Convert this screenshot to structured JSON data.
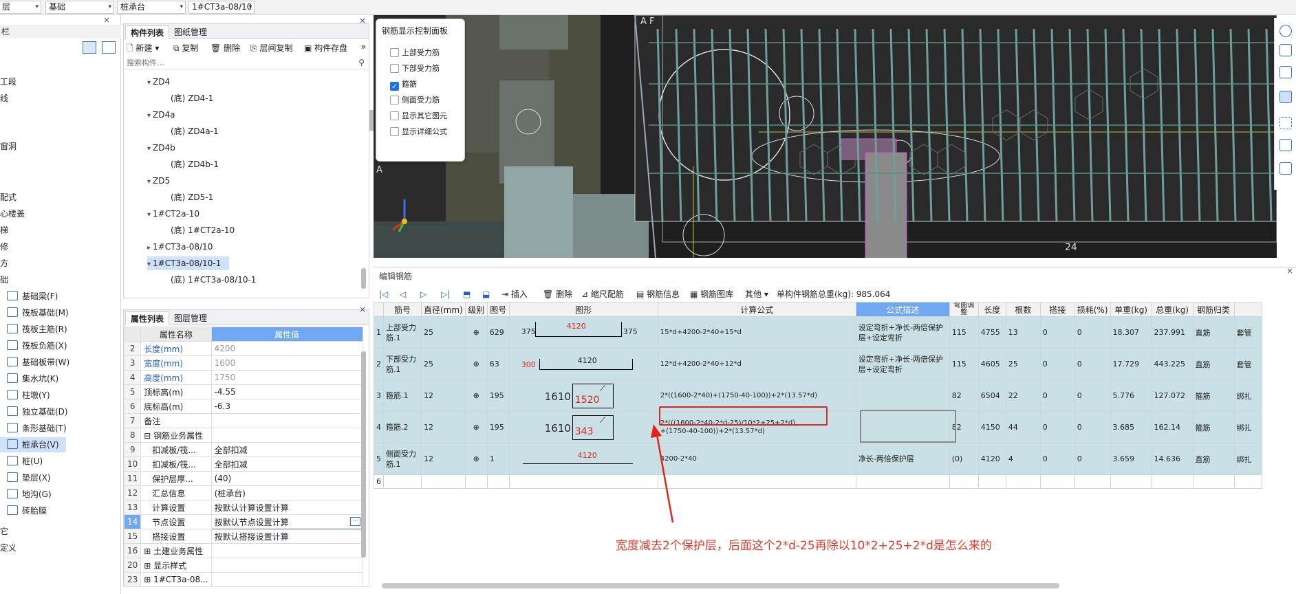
{
  "topbar": {
    "sel1": "层",
    "sel2": "基础",
    "sel3": "桩承台",
    "sel4": "1#CT3a-08/10"
  },
  "nav": {
    "header": "栏",
    "items": [
      "工段",
      "线",
      "窗洞",
      "配式",
      "心楼盖",
      "梯",
      "修",
      "方",
      "础"
    ],
    "foundation_items": [
      "基础梁(F)",
      "筏板基础(M)",
      "筏板主筋(R)",
      "筏板负筋(X)",
      "基础板带(W)",
      "集水坑(K)",
      "柱墩(Y)",
      "独立基础(D)",
      "条形基础(T)",
      "桩承台(V)",
      "桩(U)",
      "垫层(X)",
      "地沟(G)",
      "砖胎膜"
    ],
    "bottom_items": [
      "它",
      "定义"
    ]
  },
  "complist": {
    "tab_active": "构件列表",
    "tab2": "图纸管理",
    "btn_new": "新建",
    "btn_copy": "复制",
    "btn_delete": "删除",
    "btn_floor_copy": "层间复制",
    "btn_save": "构件存盘",
    "search_placeholder": "搜索构件...",
    "tree": [
      {
        "label": "ZD4",
        "level": 0,
        "arrow": "▾"
      },
      {
        "label": "(底) ZD4-1",
        "level": 1,
        "arrow": ""
      },
      {
        "label": "ZD4a",
        "level": 0,
        "arrow": "▾"
      },
      {
        "label": "(底) ZD4a-1",
        "level": 1,
        "arrow": ""
      },
      {
        "label": "ZD4b",
        "level": 0,
        "arrow": "▾"
      },
      {
        "label": "(底) ZD4b-1",
        "level": 1,
        "arrow": ""
      },
      {
        "label": "ZD5",
        "level": 0,
        "arrow": "▾"
      },
      {
        "label": "(底) ZD5-1",
        "level": 1,
        "arrow": ""
      },
      {
        "label": "1#CT2a-10",
        "level": 0,
        "arrow": "▾"
      },
      {
        "label": "(底) 1#CT2a-10",
        "level": 1,
        "arrow": ""
      },
      {
        "label": "1#CT3a-08/10",
        "level": 0,
        "arrow": "▸"
      },
      {
        "label": "1#CT3a-08/10-1",
        "level": 0,
        "arrow": "▾"
      },
      {
        "label": "(底) 1#CT3a-08/10-1",
        "level": 1,
        "arrow": ""
      }
    ]
  },
  "proplist": {
    "tab_active": "属性列表",
    "tab2": "图层管理",
    "col_name": "属性名称",
    "col_value": "属性值",
    "rows": [
      {
        "n": "2",
        "k": "长度(mm)",
        "v": "4200",
        "kc": "blue",
        "vc": "grey"
      },
      {
        "n": "3",
        "k": "宽度(mm)",
        "v": "1600",
        "kc": "blue",
        "vc": "grey"
      },
      {
        "n": "4",
        "k": "高度(mm)",
        "v": "1750",
        "kc": "blue",
        "vc": "grey"
      },
      {
        "n": "5",
        "k": "顶标高(m)",
        "v": "-4.55",
        "kc": "",
        "vc": ""
      },
      {
        "n": "6",
        "k": "底标高(m)",
        "v": "-6.3",
        "kc": "",
        "vc": ""
      },
      {
        "n": "7",
        "k": "备注",
        "v": "",
        "kc": "",
        "vc": ""
      },
      {
        "n": "8",
        "k": "⊟ 钢筋业务属性",
        "v": "",
        "kc": "",
        "vc": ""
      },
      {
        "n": "9",
        "k": "　扣减板/筏...",
        "v": "全部扣减",
        "kc": "",
        "vc": ""
      },
      {
        "n": "10",
        "k": "　扣减板/筏...",
        "v": "全部扣减",
        "kc": "",
        "vc": ""
      },
      {
        "n": "11",
        "k": "　保护层厚...",
        "v": "(40)",
        "kc": "",
        "vc": ""
      },
      {
        "n": "12",
        "k": "　汇总信息",
        "v": "(桩承台)",
        "kc": "",
        "vc": ""
      },
      {
        "n": "13",
        "k": "　计算设置",
        "v": "按默认计算设置计算",
        "kc": "",
        "vc": ""
      },
      {
        "n": "14",
        "k": "　节点设置",
        "v": "按默认节点设置计算",
        "kc": "",
        "vc": ""
      },
      {
        "n": "15",
        "k": "　搭接设置",
        "v": "按默认搭接设置计算",
        "kc": "",
        "vc": ""
      },
      {
        "n": "16",
        "k": "⊞ 土建业务属性",
        "v": "",
        "kc": "",
        "vc": ""
      },
      {
        "n": "20",
        "k": "⊞ 显示样式",
        "v": "",
        "kc": "",
        "vc": ""
      },
      {
        "n": "23",
        "k": "⊞ 1#CT3a-08...",
        "v": "",
        "kc": "",
        "vc": ""
      }
    ]
  },
  "viewport": {
    "label_af": "A F",
    "label_a": "A",
    "label_24": "24"
  },
  "ctrlpanel": {
    "title": "钢筋显示控制面板",
    "items": [
      {
        "label": "上部受力筋",
        "checked": false
      },
      {
        "label": "下部受力筋",
        "checked": false
      },
      {
        "label": "箍筋",
        "checked": true
      },
      {
        "label": "侧面受力筋",
        "checked": false
      },
      {
        "label": "显示其它图元",
        "checked": false
      },
      {
        "label": "显示详细公式",
        "checked": false
      }
    ]
  },
  "editor": {
    "title": "编辑钢筋",
    "btn_insert": "插入",
    "btn_delete": "删除",
    "btn_scale": "缩尺配筋",
    "btn_info": "钢筋信息",
    "btn_lib": "钢筋图库",
    "btn_other": "其他",
    "total_label": "单构件钢筋总重(kg): 985.064",
    "headers": [
      "筋号",
      "直径(mm)",
      "级别",
      "图号",
      "图形",
      "计算公式",
      "公式描述",
      "弯曲调整",
      "长度",
      "根数",
      "搭接",
      "损耗(%)",
      "单重(kg)",
      "总重(kg)",
      "钢筋归类",
      ""
    ],
    "rows": [
      {
        "n": "1",
        "name": "上部受力筋.1",
        "dia": "25",
        "grade": "⊕",
        "fig": "629",
        "s1": "375",
        "s2": "4120",
        "s3": "375",
        "formula": "15*d+4200-2*40+15*d",
        "desc": "设定弯折+净长-两倍保护层+设定弯折",
        "bend": "115",
        "len": "4755",
        "cnt": "13",
        "lap": "0",
        "loss": "0",
        "unit": "18.307",
        "total": "237.991",
        "cat": "直筋",
        "last": "套管"
      },
      {
        "n": "2",
        "name": "下部受力筋.1",
        "dia": "25",
        "grade": "⊕",
        "fig": "63",
        "s1": "300",
        "s2": "4120",
        "s3": "",
        "formula": "12*d+4200-2*40+12*d",
        "desc": "设定弯折+净长-两倍保护层+设定弯折",
        "bend": "115",
        "len": "4605",
        "cnt": "25",
        "lap": "0",
        "loss": "0",
        "unit": "17.729",
        "total": "443.225",
        "cat": "直筋",
        "last": "套管"
      },
      {
        "n": "3",
        "name": "箍筋.1",
        "dia": "12",
        "grade": "⊕",
        "fig": "195",
        "s1": "1610",
        "s2": "1520",
        "s3": "",
        "formula": "2*((1600-2*40)+(1750-40-100))+2*(13.57*d)",
        "desc": "",
        "bend": "82",
        "len": "6504",
        "cnt": "22",
        "lap": "0",
        "loss": "0",
        "unit": "5.776",
        "total": "127.072",
        "cat": "箍筋",
        "last": "绑扎"
      },
      {
        "n": "4",
        "name": "箍筋.2",
        "dia": "12",
        "grade": "⊕",
        "fig": "195",
        "s1": "1610",
        "s2": "343",
        "s3": "",
        "formula": "2*(((1600-2*40-2*d-25)/10*2+25+2*d)",
        "formula2": "+(1750-40-100))+2*(13.57*d)",
        "desc": "",
        "bend": "82",
        "len": "4150",
        "cnt": "44",
        "lap": "0",
        "loss": "0",
        "unit": "3.685",
        "total": "162.14",
        "cat": "箍筋",
        "last": "绑扎"
      },
      {
        "n": "5",
        "name": "侧面受力筋.1",
        "dia": "12",
        "grade": "⊕",
        "fig": "1",
        "s1": "",
        "s2": "4120",
        "s3": "",
        "formula": "4200-2*40",
        "desc": "净长-两倍保护层",
        "bend": "(0)",
        "len": "4120",
        "cnt": "4",
        "lap": "0",
        "loss": "0",
        "unit": "3.659",
        "total": "14.636",
        "cat": "直筋",
        "last": "绑扎"
      }
    ],
    "empty_row_n": "6"
  },
  "annotation": "宽度减去2个保护层，后面这个2*d-25再除以10*2+25+2*d是怎么来的"
}
